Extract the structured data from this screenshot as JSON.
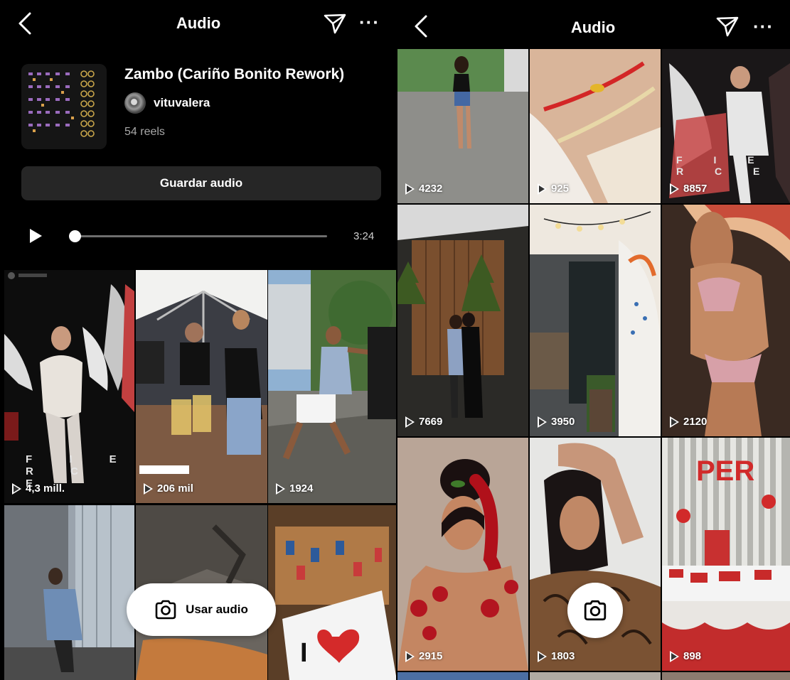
{
  "left_screen": {
    "header": {
      "title": "Audio",
      "back_icon": "chevron-left-icon",
      "send_icon": "paper-plane-icon",
      "more_label": "···"
    },
    "audio": {
      "title": "Zambo (Cariño Bonito Rework)",
      "artist": "vituvalera",
      "reels": "54 reels",
      "save_label": "Guardar audio",
      "duration": "3:24",
      "progress": 0
    },
    "tiles": [
      {
        "count": "4,3 mill.",
        "overlay_text": "F I E R C E"
      },
      {
        "count": "206 mil"
      },
      {
        "count": "1924"
      },
      {
        "count": ""
      },
      {
        "count": ""
      },
      {
        "count": ""
      }
    ],
    "use_audio_label": "Usar audio"
  },
  "right_screen": {
    "header": {
      "title": "Audio",
      "back_icon": "chevron-left-icon",
      "send_icon": "paper-plane-icon",
      "more_label": "···"
    },
    "tiles": [
      {
        "count": "4232"
      },
      {
        "count": "925"
      },
      {
        "count": "8857",
        "overlay_text": "F I E R C E"
      },
      {
        "count": "7669"
      },
      {
        "count": "3950"
      },
      {
        "count": "2120"
      },
      {
        "count": "2915"
      },
      {
        "count": "1803"
      },
      {
        "count": "898"
      }
    ],
    "camera_icon": "camera-icon"
  },
  "colors": {
    "background": "#000000",
    "button_bg": "#262626",
    "text_primary": "#ffffff",
    "text_secondary": "#a8a8a8"
  }
}
